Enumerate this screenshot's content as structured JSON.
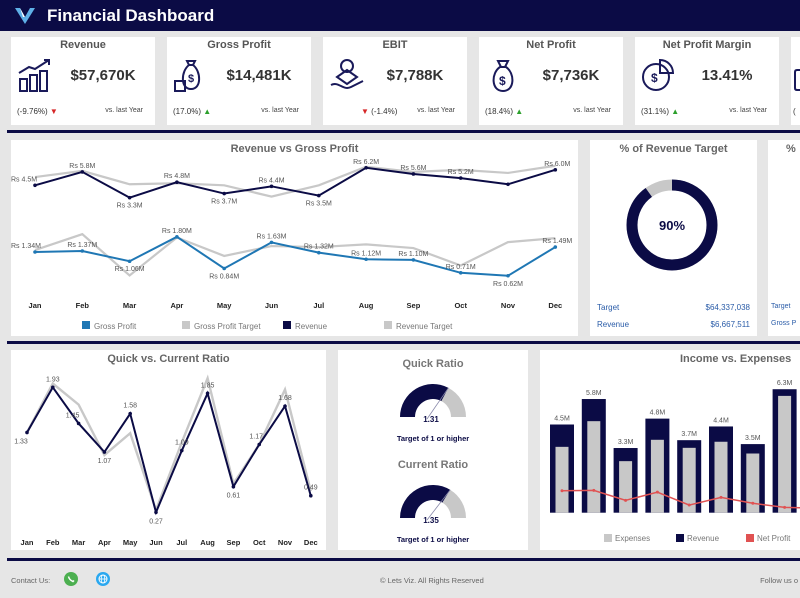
{
  "header": {
    "title": "Financial Dashboard",
    "logo_icon": "v-logo-icon"
  },
  "colors": {
    "navy": "#0b0b45",
    "blue": "#1f77b4",
    "gray": "#c8c8c8",
    "red": "#e05252",
    "up": "#2ca02c",
    "down": "#d62728"
  },
  "kpis": [
    {
      "title": "Revenue",
      "value": "$57,670K",
      "change": "(-9.76%)",
      "trend": "down",
      "compare": "vs. last Year",
      "icon": "growth-coins-icon"
    },
    {
      "title": "Gross Profit",
      "value": "$14,481K",
      "change": "(17.0%)",
      "trend": "up",
      "compare": "vs. last Year",
      "icon": "money-bag-icon"
    },
    {
      "title": "EBIT",
      "value": "$7,788K",
      "change": "(-1.4%)",
      "trend": "down",
      "compare": "vs. last Year",
      "icon": "money-hand-icon"
    },
    {
      "title": "Net Profit",
      "value": "$7,736K",
      "change": "(18.4%)",
      "trend": "up",
      "compare": "vs. last Year",
      "icon": "dollar-bag-icon"
    },
    {
      "title": "Net Profit Margin",
      "value": "13.41%",
      "change": "(31.1%)",
      "trend": "up",
      "compare": "vs. last Year",
      "icon": "pie-dollar-icon"
    }
  ],
  "kpi_partial": {
    "change": "("
  },
  "revenue_target": {
    "title": "% of Revenue Target",
    "percent": 90,
    "center_label": "90%",
    "target_label": "Target",
    "target_value": "$64,337,038",
    "revenue_label": "Revenue",
    "revenue_value": "$6,667,511"
  },
  "partial_target": {
    "title": "%",
    "target_label": "Target",
    "second_label": "Gross P"
  },
  "chart_data": [
    {
      "type": "line",
      "title": "Revenue vs Gross Profit",
      "categories": [
        "Jan",
        "Feb",
        "Mar",
        "Apr",
        "May",
        "Jun",
        "Jul",
        "Aug",
        "Sep",
        "Oct",
        "Nov",
        "Dec"
      ],
      "legend_position": "bottom",
      "series": [
        {
          "name": "Revenue",
          "color": "#0b0b45",
          "values": [
            4.5,
            5.8,
            3.3,
            4.8,
            3.7,
            4.4,
            3.5,
            6.2,
            5.6,
            5.2,
            4.6,
            6.0
          ],
          "labels": [
            "Rs 4.5M",
            "Rs 5.8M",
            "Rs 3.3M",
            "Rs 4.8M",
            "Rs 3.7M",
            "Rs 4.4M",
            "Rs 3.5M",
            "Rs 6.2M",
            "Rs 5.6M",
            "Rs 5.2M",
            "",
            "Rs 6.0M"
          ]
        },
        {
          "name": "Revenue Target",
          "color": "#c8c8c8",
          "values": [
            5.3,
            5.9,
            4.6,
            4.7,
            4.5,
            3.4,
            4.5,
            6.3,
            5.8,
            6.0,
            5.7,
            6.4
          ]
        },
        {
          "name": "Gross Profit",
          "color": "#1f77b4",
          "values": [
            1.34,
            1.37,
            1.06,
            1.8,
            0.84,
            1.63,
            1.32,
            1.12,
            1.1,
            0.71,
            0.62,
            1.49
          ],
          "labels": [
            "Rs 1.34M",
            "Rs 1.37M",
            "Rs 1.06M",
            "Rs 1.80M",
            "Rs 0.84M",
            "Rs 1.63M",
            "Rs 1.32M",
            "Rs 1.12M",
            "Rs 1.10M",
            "Rs 0.71M",
            "Rs 0.62M",
            "Rs 1.49M"
          ]
        },
        {
          "name": "Gross Profit Target",
          "color": "#c8c8c8",
          "values": [
            1.4,
            1.88,
            0.63,
            1.78,
            1.22,
            1.52,
            1.49,
            1.57,
            1.46,
            0.93,
            1.64,
            1.76
          ]
        }
      ],
      "legend": [
        "Gross Profit",
        "Gross Profit Target",
        "Revenue",
        "Revenue Target"
      ]
    },
    {
      "type": "line",
      "title": "Quick vs. Current Ratio",
      "categories": [
        "Jan",
        "Feb",
        "Mar",
        "Apr",
        "May",
        "Jun",
        "Jul",
        "Aug",
        "Sep",
        "Oct",
        "Nov",
        "Dec"
      ],
      "series": [
        {
          "color": "#c8c8c8",
          "values": [
            1.33,
            1.98,
            1.7,
            1.03,
            1.32,
            0.3,
            1.2,
            2.05,
            0.65,
            1.17,
            1.9,
            0.55
          ]
        },
        {
          "color": "#0b0b45",
          "values": [
            1.33,
            1.93,
            1.45,
            1.07,
            1.58,
            0.27,
            1.09,
            1.85,
            0.61,
            1.17,
            1.68,
            0.49
          ],
          "labels": [
            "1.33",
            "1.93",
            "1.45",
            "1.07",
            "1.58",
            "0.27",
            "1.09",
            "1.85",
            "0.61",
            "1.17",
            "1.68",
            "0.49"
          ]
        }
      ]
    },
    {
      "type": "bar",
      "title": "Income vs. Expenses",
      "legend_position": "bottom",
      "series": [
        {
          "name": "Revenue",
          "color": "#0b0b45",
          "values": [
            4.5,
            5.8,
            3.3,
            4.8,
            3.7,
            4.4,
            3.5,
            6.3
          ],
          "labels": [
            "4.5M",
            "5.8M",
            "3.3M",
            "4.8M",
            "3.7M",
            "4.4M",
            "3.5M",
            "6.3M"
          ]
        },
        {
          "name": "Expenses",
          "color": "#c8c8c8",
          "values": [
            3.36,
            4.67,
            2.63,
            3.72,
            3.31,
            3.62,
            3.02,
            5.96
          ]
        },
        {
          "name": "Net Profit",
          "color": "#e05252",
          "type": "line",
          "values": [
            1.12,
            1.14,
            0.63,
            1.05,
            0.39,
            0.78,
            0.48,
            0.27
          ]
        }
      ],
      "legend": [
        "Expenses",
        "Revenue",
        "Net Profit"
      ]
    }
  ],
  "gauges": [
    {
      "title": "Quick Ratio",
      "value": 1.31,
      "value_label": "1.31",
      "max": 2,
      "note": "Target of 1 or higher"
    },
    {
      "title": "Current Ratio",
      "value": 1.35,
      "value_label": "1.35",
      "max": 2,
      "note": "Target of 1 or higher"
    }
  ],
  "footer": {
    "contact_label": "Contact Us:",
    "copyright": "© Lets Viz. All Rights Reserved",
    "follow": "Follow us o",
    "icons": [
      "whatsapp-icon",
      "globe-icon"
    ]
  }
}
